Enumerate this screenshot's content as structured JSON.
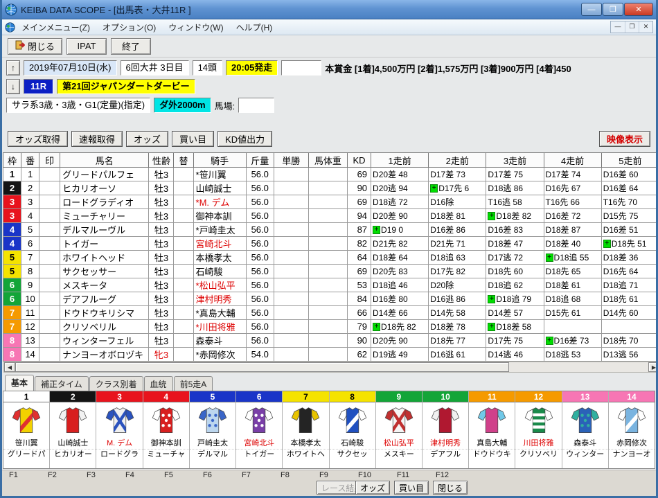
{
  "window": {
    "title": "KEIBA DATA SCOPE - [出馬表・大井11R ]",
    "controls": {
      "minimize": "—",
      "maximize": "❐",
      "close": "✕"
    },
    "mdi": {
      "minimize": "—",
      "restore": "❐",
      "close": "✕"
    }
  },
  "menu": {
    "items": [
      "メインメニュー(Z)",
      "オプション(O)",
      "ウィンドウ(W)",
      "ヘルプ(H)"
    ]
  },
  "toolbar": {
    "close_label": "閉じる",
    "ipat_label": "IPAT",
    "exit_label": "終了"
  },
  "race_info": {
    "nav_up": "↑",
    "nav_down": "↓",
    "date": "2019年07月10日(水)",
    "meeting": "6回大井 3日目",
    "head_count": "14頭",
    "start_time": "20:05発走",
    "prize": "本賞金 [1着]4,500万円 [2着]1,575万円 [3着]900万円 [4着]450",
    "race_no": "11R",
    "race_name": "第21回ジャパンダートダービー",
    "race_class": "サラ系3歳・3歳・G1(定量)(指定)",
    "course": "ダ外2000m",
    "baba_label": "馬場:"
  },
  "action_bar": {
    "buttons": [
      "オッズ取得",
      "速報取得",
      "オッズ",
      "買い目",
      "KD値出力"
    ],
    "video_button": "映像表示"
  },
  "colors": {
    "highlight_yellow": "#ffff00",
    "course_cyan": "#00e5e5",
    "race_no_blue": "#0b1fc4",
    "plus_green": "#00dd00",
    "red_text": "#dd0000"
  },
  "frame_colors": {
    "1": {
      "bg": "#ffffff",
      "fg": "#000000"
    },
    "2": {
      "bg": "#141414",
      "fg": "#ffffff"
    },
    "3": {
      "bg": "#e8131d",
      "fg": "#ffffff"
    },
    "4": {
      "bg": "#1a35c8",
      "fg": "#ffffff"
    },
    "5": {
      "bg": "#f5e300",
      "fg": "#000000"
    },
    "6": {
      "bg": "#13a538",
      "fg": "#ffffff"
    },
    "7": {
      "bg": "#f59a00",
      "fg": "#ffffff"
    },
    "8": {
      "bg": "#f776b4",
      "fg": "#ffffff"
    }
  },
  "table": {
    "headers": [
      "枠",
      "番",
      "印",
      "馬名",
      "性齢",
      "替",
      "騎手",
      "斤量",
      "単勝",
      "馬体重",
      "KD",
      "1走前",
      "2走前",
      "3走前",
      "4走前",
      "5走前"
    ],
    "rows": [
      {
        "waku": "1",
        "frame": "1",
        "num": "1",
        "mark": "",
        "name": "グリードパルフェ",
        "sexage": "牡3",
        "sexage_red": false,
        "kae": "",
        "jockey": "*笹川翼",
        "jockey_red": false,
        "weight": "56.0",
        "tansho": "",
        "bataiju": "",
        "kd": "69",
        "runs": [
          {
            "v": "D20差 48"
          },
          {
            "v": "D17差 73"
          },
          {
            "v": "D17差 75"
          },
          {
            "v": "D17差 74"
          },
          {
            "v": "D16差 60"
          }
        ]
      },
      {
        "waku": "2",
        "frame": "2",
        "num": "2",
        "mark": "",
        "name": "ヒカリオーソ",
        "sexage": "牡3",
        "sexage_red": false,
        "kae": "",
        "jockey": "山崎誠士",
        "jockey_red": false,
        "weight": "56.0",
        "tansho": "",
        "bataiju": "",
        "kd": "90",
        "runs": [
          {
            "v": "D20逃 94"
          },
          {
            "v": "D17先 6",
            "p": true
          },
          {
            "v": "D18逃 86"
          },
          {
            "v": "D16先 67"
          },
          {
            "v": "D16差 64"
          }
        ]
      },
      {
        "waku": "3",
        "frame": "3",
        "num": "3",
        "mark": "",
        "name": "ロードグラディオ",
        "sexage": "牡3",
        "sexage_red": false,
        "kae": "",
        "jockey": "*M. デム",
        "jockey_red": true,
        "weight": "56.0",
        "tansho": "",
        "bataiju": "",
        "kd": "69",
        "runs": [
          {
            "v": "D18逃 72"
          },
          {
            "v": "D16除"
          },
          {
            "v": "T16逃 58"
          },
          {
            "v": "T16先 66"
          },
          {
            "v": "T16先 70"
          }
        ]
      },
      {
        "waku": "3",
        "frame": "3",
        "num": "4",
        "mark": "",
        "name": "ミューチャリー",
        "sexage": "牡3",
        "sexage_red": false,
        "kae": "",
        "jockey": "御神本訓",
        "jockey_red": false,
        "weight": "56.0",
        "tansho": "",
        "bataiju": "",
        "kd": "94",
        "runs": [
          {
            "v": "D20差 90"
          },
          {
            "v": "D18差 81"
          },
          {
            "v": "D18差 82",
            "p": true
          },
          {
            "v": "D16差 72"
          },
          {
            "v": "D15先 75"
          }
        ]
      },
      {
        "waku": "4",
        "frame": "4",
        "num": "5",
        "mark": "",
        "name": "デルマルーヴル",
        "sexage": "牡3",
        "sexage_red": false,
        "kae": "",
        "jockey": "*戸崎圭太",
        "jockey_red": false,
        "weight": "56.0",
        "tansho": "",
        "bataiju": "",
        "kd": "87",
        "runs": [
          {
            "v": "D19 0",
            "p": true
          },
          {
            "v": "D16差 86"
          },
          {
            "v": "D16差 83"
          },
          {
            "v": "D18差 87"
          },
          {
            "v": "D16差 51"
          }
        ]
      },
      {
        "waku": "4",
        "frame": "4",
        "num": "6",
        "mark": "",
        "name": "トイガー",
        "sexage": "牡3",
        "sexage_red": false,
        "kae": "",
        "jockey": "宮崎北斗",
        "jockey_red": true,
        "weight": "56.0",
        "tansho": "",
        "bataiju": "",
        "kd": "82",
        "runs": [
          {
            "v": "D21先 82"
          },
          {
            "v": "D21先 71"
          },
          {
            "v": "D18差 47"
          },
          {
            "v": "D18差 40"
          },
          {
            "v": "D18先 51",
            "p": true
          }
        ]
      },
      {
        "waku": "5",
        "frame": "5",
        "num": "7",
        "mark": "",
        "name": "ホワイトヘッド",
        "sexage": "牡3",
        "sexage_red": false,
        "kae": "",
        "jockey": "本橋孝太",
        "jockey_red": false,
        "weight": "56.0",
        "tansho": "",
        "bataiju": "",
        "kd": "64",
        "runs": [
          {
            "v": "D18差 64"
          },
          {
            "v": "D18追 63"
          },
          {
            "v": "D17逃 72"
          },
          {
            "v": "D18追 55",
            "p": true
          },
          {
            "v": "D18差 36"
          }
        ]
      },
      {
        "waku": "5",
        "frame": "5",
        "num": "8",
        "mark": "",
        "name": "サクセッサー",
        "sexage": "牡3",
        "sexage_red": false,
        "kae": "",
        "jockey": "石崎駿",
        "jockey_red": false,
        "weight": "56.0",
        "tansho": "",
        "bataiju": "",
        "kd": "69",
        "runs": [
          {
            "v": "D20先 83"
          },
          {
            "v": "D17先 82"
          },
          {
            "v": "D18先 60"
          },
          {
            "v": "D18先 65"
          },
          {
            "v": "D16先 64"
          }
        ]
      },
      {
        "waku": "6",
        "frame": "6",
        "num": "9",
        "mark": "",
        "name": "メスキータ",
        "sexage": "牡3",
        "sexage_red": false,
        "kae": "",
        "jockey": "*松山弘平",
        "jockey_red": true,
        "weight": "56.0",
        "tansho": "",
        "bataiju": "",
        "kd": "53",
        "runs": [
          {
            "v": "D18追 46"
          },
          {
            "v": "D20除"
          },
          {
            "v": "D18追 62"
          },
          {
            "v": "D18差 61"
          },
          {
            "v": "D18追 71"
          }
        ]
      },
      {
        "waku": "6",
        "frame": "6",
        "num": "10",
        "mark": "",
        "name": "デアフルーグ",
        "sexage": "牡3",
        "sexage_red": false,
        "kae": "",
        "jockey": "津村明秀",
        "jockey_red": true,
        "weight": "56.0",
        "tansho": "",
        "bataiju": "",
        "kd": "84",
        "runs": [
          {
            "v": "D16差 80"
          },
          {
            "v": "D16逃 86"
          },
          {
            "v": "D18追 79",
            "p": true
          },
          {
            "v": "D18追 68"
          },
          {
            "v": "D18先 61"
          }
        ]
      },
      {
        "waku": "7",
        "frame": "7",
        "num": "11",
        "mark": "",
        "name": "ドウドウキリシマ",
        "sexage": "牡3",
        "sexage_red": false,
        "kae": "",
        "jockey": "*真島大輔",
        "jockey_red": false,
        "weight": "56.0",
        "tansho": "",
        "bataiju": "",
        "kd": "66",
        "runs": [
          {
            "v": "D14差 66"
          },
          {
            "v": "D14先 58"
          },
          {
            "v": "D14差 57"
          },
          {
            "v": "D15先 61"
          },
          {
            "v": "D14先 60"
          }
        ]
      },
      {
        "waku": "7",
        "frame": "7",
        "num": "12",
        "mark": "",
        "name": "クリソベリル",
        "sexage": "牡3",
        "sexage_red": false,
        "kae": "",
        "jockey": "*川田将雅",
        "jockey_red": true,
        "weight": "56.0",
        "tansho": "",
        "bataiju": "",
        "kd": "79",
        "runs": [
          {
            "v": "D18先 82",
            "p": true
          },
          {
            "v": "D18差 78"
          },
          {
            "v": "D18差 58",
            "p": true
          },
          {
            "v": ""
          },
          {
            "v": ""
          }
        ]
      },
      {
        "waku": "8",
        "frame": "8",
        "num": "13",
        "mark": "",
        "name": "ウィンターフェル",
        "sexage": "牡3",
        "sexage_red": false,
        "kae": "",
        "jockey": "森泰斗",
        "jockey_red": false,
        "weight": "56.0",
        "tansho": "",
        "bataiju": "",
        "kd": "90",
        "runs": [
          {
            "v": "D20先 90"
          },
          {
            "v": "D18先 77"
          },
          {
            "v": "D17先 75"
          },
          {
            "v": "D16差 73",
            "p": true
          },
          {
            "v": "D18先 70"
          }
        ]
      },
      {
        "waku": "8",
        "frame": "8",
        "num": "14",
        "mark": "",
        "name": "ナンヨーオボロヅキ",
        "sexage": "牝3",
        "sexage_red": true,
        "kae": "",
        "jockey": "*赤岡修次",
        "jockey_red": false,
        "weight": "54.0",
        "tansho": "",
        "bataiju": "",
        "kd": "62",
        "runs": [
          {
            "v": "D19逃 49"
          },
          {
            "v": "D16逃 61"
          },
          {
            "v": "D14逃 46"
          },
          {
            "v": "D18逃 53"
          },
          {
            "v": "D13逃 56"
          }
        ]
      }
    ]
  },
  "scrollbar": {
    "left": "◀",
    "right": "▶"
  },
  "tabs": {
    "items": [
      "基本",
      "補正タイム",
      "クラス別着",
      "血統",
      "前5走A"
    ],
    "active": 0
  },
  "silks": {
    "columns": [
      {
        "num": "1",
        "frame": "1",
        "jockey": "笹川翼",
        "jockey_red": false,
        "horse": "グリードパ",
        "body": "#f2d100",
        "sleeve": "#e03030",
        "pattern": "sash"
      },
      {
        "num": "2",
        "frame": "2",
        "jockey": "山崎誠士",
        "jockey_red": false,
        "horse": "ヒカリオー",
        "body": "#d81f1f",
        "sleeve": "#f2f2f2",
        "pattern": "plain"
      },
      {
        "num": "3",
        "frame": "3",
        "jockey": "M. デム",
        "jockey_red": true,
        "horse": "ロードグラ",
        "body": "#f0f0f0",
        "sleeve": "#2a52be",
        "pattern": "cross"
      },
      {
        "num": "4",
        "frame": "3",
        "jockey": "御神本訓",
        "jockey_red": false,
        "horse": "ミューチャ",
        "body": "#d81f1f",
        "sleeve": "#ffffff",
        "pattern": "dots"
      },
      {
        "num": "5",
        "frame": "4",
        "jockey": "戸崎圭太",
        "jockey_red": false,
        "horse": "デルマル",
        "body": "#bcd6ee",
        "sleeve": "#3a66c8",
        "pattern": "dots"
      },
      {
        "num": "6",
        "frame": "4",
        "jockey": "宮崎北斗",
        "jockey_red": true,
        "horse": "トイガー",
        "body": "#7a3fa8",
        "sleeve": "#ffffff",
        "pattern": "dots"
      },
      {
        "num": "7",
        "frame": "5",
        "jockey": "本橋孝太",
        "jockey_red": false,
        "horse": "ホワイトヘ",
        "body": "#242424",
        "sleeve": "#e8c400",
        "pattern": "plain"
      },
      {
        "num": "8",
        "frame": "5",
        "jockey": "石崎駿",
        "jockey_red": false,
        "horse": "サクセッ",
        "body": "#2050c0",
        "sleeve": "#ffffff",
        "pattern": "sash"
      },
      {
        "num": "9",
        "frame": "6",
        "jockey": "松山弘平",
        "jockey_red": true,
        "horse": "メスキー",
        "body": "#f5f5f5",
        "sleeve": "#c03030",
        "pattern": "cross"
      },
      {
        "num": "10",
        "frame": "6",
        "jockey": "津村明秀",
        "jockey_red": true,
        "horse": "デアフル",
        "body": "#b01830",
        "sleeve": "#f0f0f0",
        "pattern": "plain"
      },
      {
        "num": "11",
        "frame": "7",
        "jockey": "真島大輔",
        "jockey_red": false,
        "horse": "ドウドウキ",
        "body": "#d0408a",
        "sleeve": "#70c8e8",
        "pattern": "plain"
      },
      {
        "num": "12",
        "frame": "7",
        "jockey": "川田将雅",
        "jockey_red": true,
        "horse": "クリソベリ",
        "body": "#1a8a4a",
        "sleeve": "#ffffff",
        "pattern": "hoops"
      },
      {
        "num": "13",
        "frame": "8",
        "jockey": "森泰斗",
        "jockey_red": false,
        "horse": "ウィンター",
        "body": "#2a62b8",
        "sleeve": "#30b0a0",
        "pattern": "dots"
      },
      {
        "num": "14",
        "frame": "8",
        "jockey": "赤岡修次",
        "jockey_red": false,
        "horse": "ナンヨーオ",
        "body": "#7ab4e0",
        "sleeve": "#ffffff",
        "pattern": "sash"
      }
    ]
  },
  "fkeys": {
    "labels": [
      "F1",
      "F2",
      "F3",
      "F4",
      "F5",
      "F6",
      "F7",
      "F8",
      "F9",
      "F10",
      "F11",
      "F12"
    ],
    "buttons": [
      {
        "slot": 9,
        "label": "レース結果",
        "disabled": true
      },
      {
        "slot": 10,
        "label": "オッズ",
        "disabled": false
      },
      {
        "slot": 11,
        "label": "買い目",
        "disabled": false
      },
      {
        "slot": 12,
        "label": "閉じる",
        "disabled": false
      }
    ]
  }
}
